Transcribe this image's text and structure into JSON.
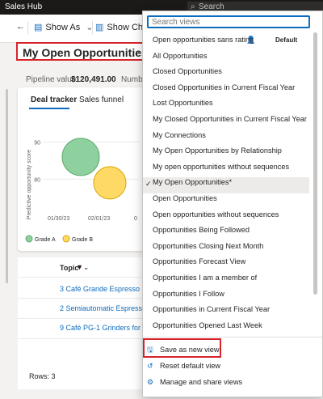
{
  "app": {
    "title": "Sales Hub",
    "search_placeholder": "Search"
  },
  "command_bar": {
    "back_icon": "back-arrow-icon",
    "show_as_label": "Show As",
    "show_chart_label": "Show Chart"
  },
  "view": {
    "title": "My Open Opportunities*"
  },
  "pipeline": {
    "label": "Pipeline value",
    "value": "$120,491.00",
    "number_label": "Numbe"
  },
  "chart_card": {
    "tabs": [
      "Deal tracker",
      "Sales funnel"
    ],
    "ylabel": "Predictive opportunity score",
    "y_ticks": [
      "90",
      "80"
    ],
    "x_ticks": [
      "01/30/23",
      "02/01/23",
      "0"
    ],
    "legend": [
      {
        "name": "Grade A",
        "color": "#8fd19e"
      },
      {
        "name": "Grade B",
        "color": "#ffd966"
      }
    ]
  },
  "chart_data": {
    "type": "scatter",
    "ylabel": "Predictive opportunity score",
    "x_ticks": [
      "01/30/23",
      "02/01/23"
    ],
    "y_ticks": [
      90,
      80
    ],
    "series": [
      {
        "name": "Grade A",
        "points": [
          {
            "x": "01/31/23",
            "y": 86
          }
        ]
      },
      {
        "name": "Grade B",
        "points": [
          {
            "x": "02/01/23",
            "y": 79
          }
        ]
      }
    ],
    "legend_position": "bottom"
  },
  "table": {
    "header": "Topic",
    "required_marker": "*",
    "rows": [
      "3 Café Grande Espresso Mac",
      "2 Semiautomatic Espresso M",
      "9 Café PG-1 Grinders for A. D"
    ],
    "rows_count": "Rows: 3"
  },
  "dropdown": {
    "search_placeholder": "Search views",
    "default_badge": "Default",
    "items": [
      "Open opportunities sans rating",
      "All Opportunities",
      "Closed Opportunities",
      "Closed Opportunities in Current Fiscal Year",
      "Lost Opportunities",
      "My Closed Opportunities in Current Fiscal Year",
      "My Connections",
      "My Open Opportunities by Relationship",
      "My open opportunities without sequences",
      "My Open Opportunities*",
      "Open Opportunities",
      "Open opportunities without sequences",
      "Opportunities Being Followed",
      "Opportunities Closing Next Month",
      "Opportunities Forecast View",
      "Opportunities I am a member of",
      "Opportunities I Follow",
      "Opportunities in Current Fiscal Year",
      "Opportunities Opened Last Week"
    ],
    "selected_index": 9,
    "actions": [
      "Save as new view",
      "Reset default view",
      "Manage and share views"
    ]
  }
}
